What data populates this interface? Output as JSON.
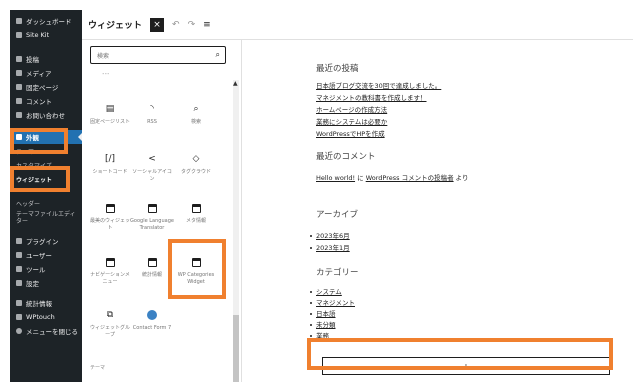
{
  "sidebar": {
    "items": [
      {
        "label": "ダッシュボード"
      },
      {
        "label": "Site Kit"
      },
      {
        "label": "投稿"
      },
      {
        "label": "メディア"
      },
      {
        "label": "固定ページ"
      },
      {
        "label": "コメント"
      },
      {
        "label": "お問い合わせ"
      },
      {
        "label": "外観"
      },
      {
        "label": "テーマ"
      },
      {
        "label": "カスタマイズ"
      },
      {
        "label": "ウィジェット"
      },
      {
        "label": "ヘッダー"
      },
      {
        "label": "テーマファイルエディター"
      },
      {
        "label": "プラグイン"
      },
      {
        "label": "ユーザー"
      },
      {
        "label": "ツール"
      },
      {
        "label": "設定"
      },
      {
        "label": "統計情報"
      },
      {
        "label": "WPtouch"
      },
      {
        "label": "メニューを閉じる"
      }
    ]
  },
  "topbar": {
    "title": "ウィジェット",
    "close": "×",
    "undo": "↶",
    "redo": "↷",
    "list_view": "≡"
  },
  "inserter": {
    "search_placeholder": "検索",
    "blocks": [
      {
        "label": "固定ページリスト",
        "icon": "page-list-icon"
      },
      {
        "label": "RSS",
        "icon": "rss-icon"
      },
      {
        "label": "検索",
        "icon": "search-icon"
      },
      {
        "label": "ショートコード",
        "icon": "shortcode-icon"
      },
      {
        "label": "ソーシャルアイコン",
        "icon": "share-icon"
      },
      {
        "label": "タグクラウド",
        "icon": "tag-icon"
      },
      {
        "label": "最美のウィジェット",
        "icon": "calendar-icon"
      },
      {
        "label": "Google Language Translator",
        "icon": "calendar-icon"
      },
      {
        "label": "メタ情報",
        "icon": "calendar-icon"
      },
      {
        "label": "ナビゲーションメニュー",
        "icon": "calendar-icon"
      },
      {
        "label": "統計情報",
        "icon": "calendar-icon"
      },
      {
        "label": "WP Categories Widget",
        "icon": "calendar-icon"
      },
      {
        "label": "ウィジェットグループ",
        "icon": "group-icon"
      },
      {
        "label": "Contact Form 7",
        "icon": "contact-form-icon"
      }
    ],
    "section_label": "テーマ"
  },
  "preview": {
    "recent_posts_heading": "最近の投稿",
    "recent_posts": [
      "日本語ブログ交流を30回で達成しました。",
      "マネジメントの教科書を作成します！",
      "ホームページの作成方法",
      "業務にシステムは必要か",
      "WordPressでHPを作成"
    ],
    "recent_comments_heading": "最近のコメント",
    "comment": {
      "link": "Hello world!",
      "mid": " に ",
      "author": "WordPress コメントの投稿者",
      "tail": " より"
    },
    "archives_heading": "アーカイブ",
    "archives": [
      "2023年6月",
      "2023年1月"
    ],
    "categories_heading": "カテゴリー",
    "categories": [
      "システム",
      "マネジメント",
      "日本語",
      "未分類",
      "業務"
    ],
    "add_block": "+"
  }
}
